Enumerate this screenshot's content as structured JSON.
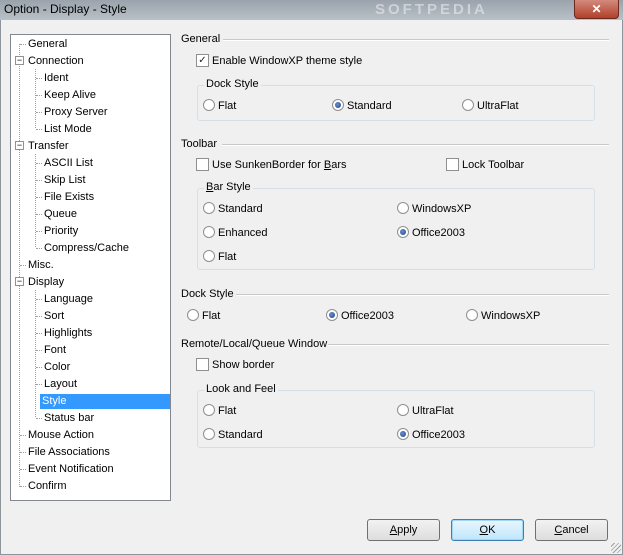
{
  "window": {
    "title": "Option - Display - Style",
    "watermark": "SOFTPEDIA",
    "close_glyph": "✕"
  },
  "tree": {
    "items": [
      {
        "label": "General"
      },
      {
        "label": "Connection"
      },
      {
        "label": "Ident"
      },
      {
        "label": "Keep Alive"
      },
      {
        "label": "Proxy Server"
      },
      {
        "label": "List Mode"
      },
      {
        "label": "Transfer"
      },
      {
        "label": "ASCII List"
      },
      {
        "label": "Skip List"
      },
      {
        "label": "File Exists"
      },
      {
        "label": "Queue"
      },
      {
        "label": "Priority"
      },
      {
        "label": "Compress/Cache"
      },
      {
        "label": "Misc."
      },
      {
        "label": "Display"
      },
      {
        "label": "Language"
      },
      {
        "label": "Sort"
      },
      {
        "label": "Highlights"
      },
      {
        "label": "Font"
      },
      {
        "label": "Color"
      },
      {
        "label": "Layout"
      },
      {
        "label": "Style"
      },
      {
        "label": "Status bar"
      },
      {
        "label": "Mouse Action"
      },
      {
        "label": "File Associations"
      },
      {
        "label": "Event Notification"
      },
      {
        "label": "Confirm"
      }
    ],
    "selected": "Style",
    "expander_glyph": "−"
  },
  "general": {
    "title": "General",
    "enable_xp_theme": {
      "label": "Enable WindowXP theme style",
      "checked": true,
      "mark": "✓"
    },
    "dock_style": {
      "title": "Dock Style",
      "options": [
        "Flat",
        "Standard",
        "UltraFlat"
      ],
      "selected": "Standard"
    }
  },
  "toolbar": {
    "title": "Toolbar",
    "sunken_border": {
      "label_pre": "Use SunkenBorder for ",
      "label_u": "B",
      "label_post": "ars",
      "checked": false
    },
    "lock_toolbar": {
      "label": "Lock Toolbar",
      "checked": false
    },
    "bar_style": {
      "title_u": "B",
      "title_rest": "ar Style",
      "options": [
        "Standard",
        "WindowsXP",
        "Enhanced",
        "Office2003",
        "Flat"
      ],
      "selected": "Office2003"
    }
  },
  "dock_style": {
    "title": "Dock Style",
    "options": [
      "Flat",
      "Office2003",
      "WindowsXP"
    ],
    "selected": "Office2003"
  },
  "rlq_window": {
    "title": "Remote/Local/Queue Window",
    "show_border": {
      "label": "Show border",
      "checked": false
    },
    "look_and_feel": {
      "title": "Look and Feel",
      "options": [
        "Flat",
        "UltraFlat",
        "Standard",
        "Office2003"
      ],
      "selected": "Office2003"
    }
  },
  "buttons": {
    "apply": {
      "u": "A",
      "rest": "pply"
    },
    "ok": {
      "u": "O",
      "rest": "K"
    },
    "cancel": {
      "u": "C",
      "rest": "ancel"
    }
  }
}
